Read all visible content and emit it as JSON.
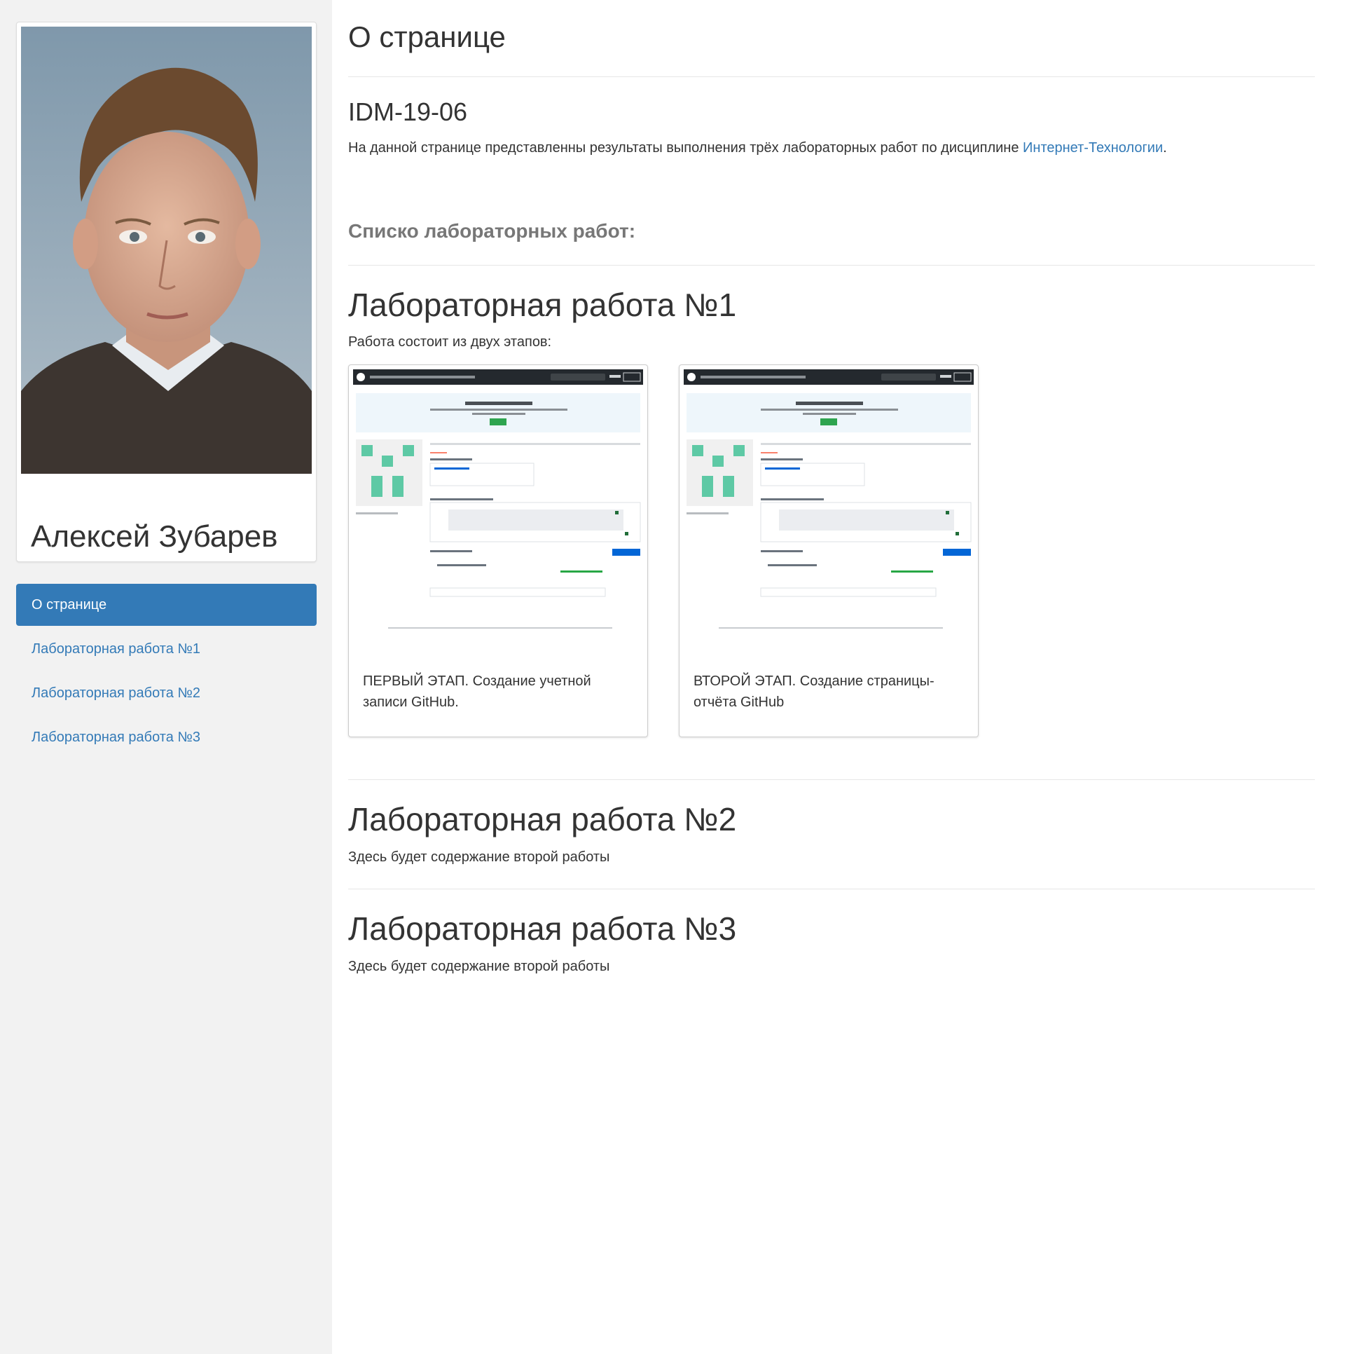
{
  "sidebar": {
    "profile_name": "Алексей Зубарев",
    "nav": [
      {
        "label": "О странице",
        "active": true
      },
      {
        "label": "Лабораторная работа №1",
        "active": false
      },
      {
        "label": "Лабораторная работа №2",
        "active": false
      },
      {
        "label": "Лабораторная работа №3",
        "active": false
      }
    ]
  },
  "main": {
    "page_title": "О странице",
    "group_code": "IDM-19-06",
    "intro_text": "На данной странице представленны результаты выполнения трёх лабораторных работ по дисциплине ",
    "intro_link": "Интернет-Технологии",
    "intro_end": ".",
    "list_title": "Списко лабораторных работ:",
    "lab1": {
      "title": "Лабораторная работа №1",
      "text": "Работа состоит из двух этапов:",
      "cards": [
        {
          "caption": "ПЕРВЫЙ ЭТАП. Создание учетной записи GitHub."
        },
        {
          "caption": "ВТОРОЙ ЭТАП. Создание страницы-отчёта GitHub"
        }
      ]
    },
    "lab2": {
      "title": "Лабораторная работа №2",
      "text": "Здесь будет содержание второй работы"
    },
    "lab3": {
      "title": "Лабораторная работа №3",
      "text": "Здесь будет содержание второй работы"
    }
  },
  "colors": {
    "accent": "#337ab7",
    "sidebar_bg": "#f2f2f2",
    "muted": "#777777"
  }
}
